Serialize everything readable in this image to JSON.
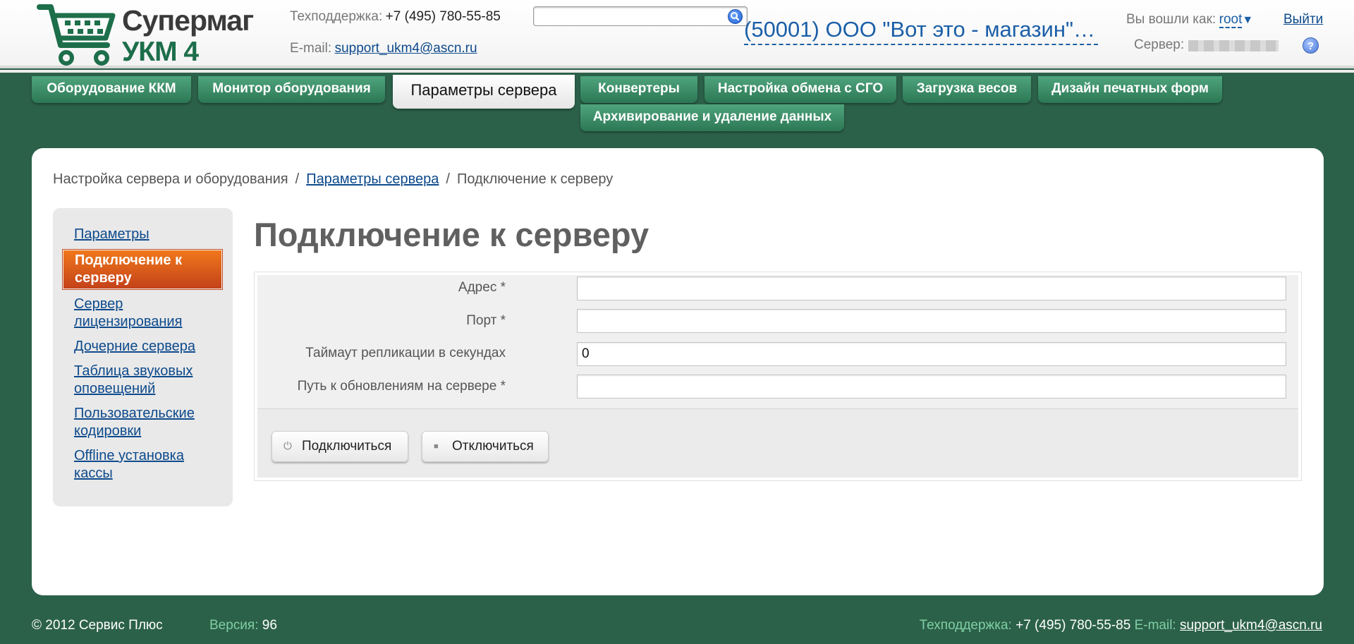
{
  "header": {
    "logo": {
      "line1": "Супермаг",
      "line2": "УКМ 4"
    },
    "support_label": "Техподдержка:",
    "support_phone": "+7 (495) 780-55-85",
    "email_label": "E-mail:",
    "email": "support_ukm4@ascn.ru",
    "search": {
      "value": "",
      "placeholder": ""
    },
    "store_name": "(50001) ООО \"Вот это - магазин\" (...",
    "user_label": "Вы вошли как:",
    "user_name": "root",
    "logout": "Выйти",
    "server_label": "Сервер:"
  },
  "tabs": [
    {
      "label": "Оборудование ККМ",
      "active": false
    },
    {
      "label": "Монитор оборудования",
      "active": false
    },
    {
      "label": "Параметры сервера",
      "active": true
    },
    {
      "label": "Конвертеры",
      "active": false
    },
    {
      "label": "Настройка обмена с СГО",
      "active": false
    },
    {
      "label": "Загрузка весов",
      "active": false
    },
    {
      "label": "Дизайн печатных форм",
      "active": false
    },
    {
      "label": "Архивирование и удаление данных",
      "active": false
    }
  ],
  "breadcrumb": {
    "item1": "Настройка сервера и оборудования",
    "item2": "Параметры сервера",
    "item3": "Подключение к серверу",
    "sep": "/"
  },
  "sidebar": {
    "items": [
      {
        "label": "Параметры",
        "active": false
      },
      {
        "label": "Подключение к серверу",
        "active": true
      },
      {
        "label": "Сервер лицензирования",
        "active": false
      },
      {
        "label": "Дочерние сервера",
        "active": false
      },
      {
        "label": "Таблица звуковых оповещений",
        "active": false
      },
      {
        "label": "Пользовательские кодировки",
        "active": false
      },
      {
        "label": "Offline установка кассы",
        "active": false
      }
    ]
  },
  "main": {
    "title": "Подключение к серверу",
    "fields": [
      {
        "label": "Адрес *",
        "value": ""
      },
      {
        "label": "Порт *",
        "value": ""
      },
      {
        "label": "Таймаут репликации в секундах",
        "value": "0"
      },
      {
        "label": "Путь к обновлениям на сервере *",
        "value": ""
      }
    ],
    "buttons": {
      "connect": "Подключиться",
      "disconnect": "Отключиться"
    }
  },
  "footer": {
    "copyright": "© 2012 Сервис Плюс",
    "version_label": "Версия:",
    "version": "96",
    "support_label": "Техподдержка:",
    "support_phone": "+7 (495) 780-55-85",
    "email_label": "E-mail:",
    "email": "support_ukm4@ascn.ru"
  },
  "colors": {
    "background": "#2c6149",
    "tab": "#3b8a63",
    "active_side": "#e05a1d",
    "link": "#0d4a8c"
  }
}
